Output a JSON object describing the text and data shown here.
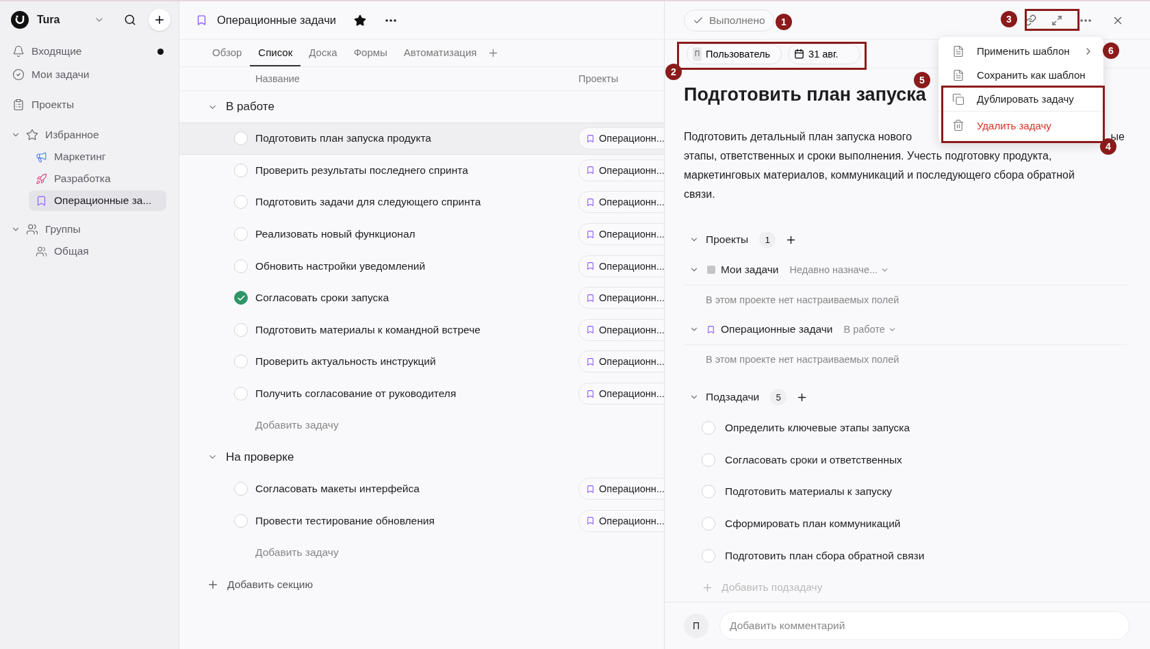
{
  "workspace": {
    "name": "Tura"
  },
  "sidebar": {
    "nav": [
      {
        "label": "Входящие",
        "unread": true,
        "selected": false
      },
      {
        "label": "Мои задачи",
        "unread": false,
        "selected": false
      },
      {
        "label": "Проекты",
        "unread": false,
        "selected": false
      }
    ],
    "groups": [
      {
        "label": "Избранное",
        "expanded": true,
        "children": [
          {
            "label": "Маркетинг",
            "selected": false
          },
          {
            "label": "Разработка",
            "selected": false
          },
          {
            "label": "Операционные за...",
            "selected": true
          }
        ]
      },
      {
        "label": "Группы",
        "expanded": true,
        "children": [
          {
            "label": "Общая",
            "selected": false
          }
        ]
      }
    ]
  },
  "project": {
    "title": "Операционные задачи",
    "starred": true,
    "tabs": [
      {
        "label": "Обзор",
        "selected": false
      },
      {
        "label": "Список",
        "selected": true
      },
      {
        "label": "Доска",
        "selected": false
      },
      {
        "label": "Формы",
        "selected": false
      },
      {
        "label": "Автоматизация",
        "selected": false
      }
    ],
    "columns": [
      "Название",
      "Проекты"
    ],
    "sections": [
      {
        "name": "В работе",
        "expanded": true,
        "add_label": "Добавить задачу",
        "tasks": [
          {
            "title": "Подготовить план запуска продукта",
            "done": false,
            "selected": true,
            "project": "Операционн..."
          },
          {
            "title": "Проверить результаты последнего спринта",
            "done": false,
            "selected": false,
            "project": "Операционн..."
          },
          {
            "title": "Подготовить задачи для следующего спринта",
            "done": false,
            "selected": false,
            "project": "Операционн..."
          },
          {
            "title": "Реализовать новый функционал",
            "done": false,
            "selected": false,
            "project": "Операционн..."
          },
          {
            "title": "Обновить настройки уведомлений",
            "done": false,
            "selected": false,
            "project": "Операционн..."
          },
          {
            "title": "Согласовать сроки запуска",
            "done": true,
            "selected": false,
            "project": "Операционн..."
          },
          {
            "title": "Подготовить материалы к командной встрече",
            "done": false,
            "selected": false,
            "project": "Операционн..."
          },
          {
            "title": "Проверить актуальность инструкций",
            "done": false,
            "selected": false,
            "project": "Операционн..."
          },
          {
            "title": "Получить согласование от руководителя",
            "done": false,
            "selected": false,
            "project": "Операционн..."
          }
        ]
      },
      {
        "name": "На проверке",
        "expanded": true,
        "add_label": "Добавить задачу",
        "tasks": [
          {
            "title": "Согласовать макеты интерфейса",
            "done": false,
            "selected": false,
            "project": "Операционн..."
          },
          {
            "title": "Провести тестирование обновления",
            "done": false,
            "selected": false,
            "project": "Операционн..."
          }
        ]
      }
    ],
    "add_section": "Добавить секцию"
  },
  "detail": {
    "done_button": "Выполнено",
    "assignee": {
      "initial": "П",
      "name": "Пользователь"
    },
    "due": "31 авг.",
    "title": "Подготовить план запуска",
    "description": {
      "lead": "Подготовить детальный план запуска нового",
      "tail": "ые",
      "rest": "этапы, ответственных и сроки выполнения. Учесть подготовку продукта, маркетинговых материалов, коммуникаций и последующего сбора обратной связи."
    },
    "projects": {
      "label": "Проекты",
      "count": "1",
      "expanded": true,
      "items": [
        {
          "kind": "personal",
          "name": "Мои задачи",
          "section": "Недавно назначе...",
          "note": "В этом проекте нет настраиваемых полей",
          "expanded": true
        },
        {
          "kind": "project",
          "name": "Операционные задачи",
          "section": "В работе",
          "note": "В этом проекте нет настраиваемых полей",
          "expanded": true
        }
      ]
    },
    "subtasks": {
      "label": "Подзадачи",
      "count": "5",
      "expanded": true,
      "add_label": "Добавить подзадачу",
      "items": [
        {
          "title": "Определить ключевые этапы запуска",
          "done": false
        },
        {
          "title": "Согласовать сроки и ответственных",
          "done": false
        },
        {
          "title": "Подготовить материалы к запуску",
          "done": false
        },
        {
          "title": "Сформировать план коммуникаций",
          "done": false
        },
        {
          "title": "Подготовить план сбора обратной связи",
          "done": false
        }
      ]
    },
    "comment": {
      "avatar": "П",
      "placeholder": "Добавить комментарий"
    }
  },
  "menu": {
    "items": [
      {
        "label": "Применить шаблон",
        "submenu": true,
        "danger": false
      },
      {
        "label": "Сохранить как шаблон",
        "submenu": false,
        "danger": false
      },
      {
        "label": "Дублировать задачу",
        "submenu": false,
        "danger": false
      },
      {
        "label": "Удалить задачу",
        "submenu": false,
        "danger": true
      }
    ]
  },
  "annotations": [
    {
      "number": "1"
    },
    {
      "number": "2"
    },
    {
      "number": "3"
    },
    {
      "number": "4"
    },
    {
      "number": "5"
    },
    {
      "number": "6"
    }
  ]
}
